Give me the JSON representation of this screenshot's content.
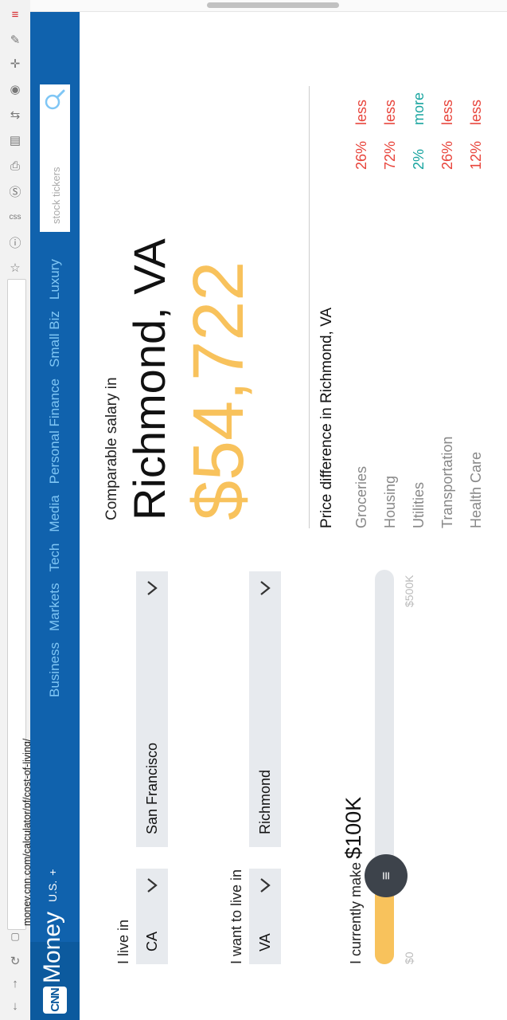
{
  "browser": {
    "url": "money.cnn.com/calculator/pf/cost-of-living/",
    "toolbar_icons": [
      "back-icon",
      "forward-icon",
      "reload-icon",
      "page-icon",
      "info-icon",
      "css-icon",
      "s-icon",
      "print-icon",
      "dns-icon",
      "share-icon",
      "camera-icon",
      "resize-icon",
      "edit-icon",
      "menu-icon"
    ]
  },
  "header": {
    "logo": "CNN",
    "brand": "Money",
    "edition": "U.S.",
    "edition_plus": "+",
    "nav": [
      "Business",
      "Markets",
      "Tech",
      "Media",
      "Personal Finance",
      "Small Biz",
      "Luxury"
    ],
    "search_placeholder": "stock tickers"
  },
  "form": {
    "live_label": "I live in",
    "live_state": "CA",
    "live_city": "San Francisco",
    "want_label": "I want to live in",
    "want_state": "VA",
    "want_city": "Richmond",
    "income_label": "I currently make",
    "income_value": "$100K",
    "slider_min": "$0",
    "slider_max": "$500K",
    "slider_fraction": 0.2
  },
  "results": {
    "comparable_label": "Comparable salary in",
    "city": "Richmond, VA",
    "salary": "$54,722",
    "price_diff_label": "Price difference in Richmond, VA",
    "rows": [
      {
        "category": "Groceries",
        "percent": "26%",
        "direction": "less"
      },
      {
        "category": "Housing",
        "percent": "72%",
        "direction": "less"
      },
      {
        "category": "Utilities",
        "percent": "2%",
        "direction": "more"
      },
      {
        "category": "Transportation",
        "percent": "26%",
        "direction": "less"
      },
      {
        "category": "Health Care",
        "percent": "12%",
        "direction": "less"
      }
    ]
  },
  "colors": {
    "header": "#1062ad",
    "accent": "#f8c25c",
    "less": "#e8453c",
    "more": "#1aa5a0"
  }
}
